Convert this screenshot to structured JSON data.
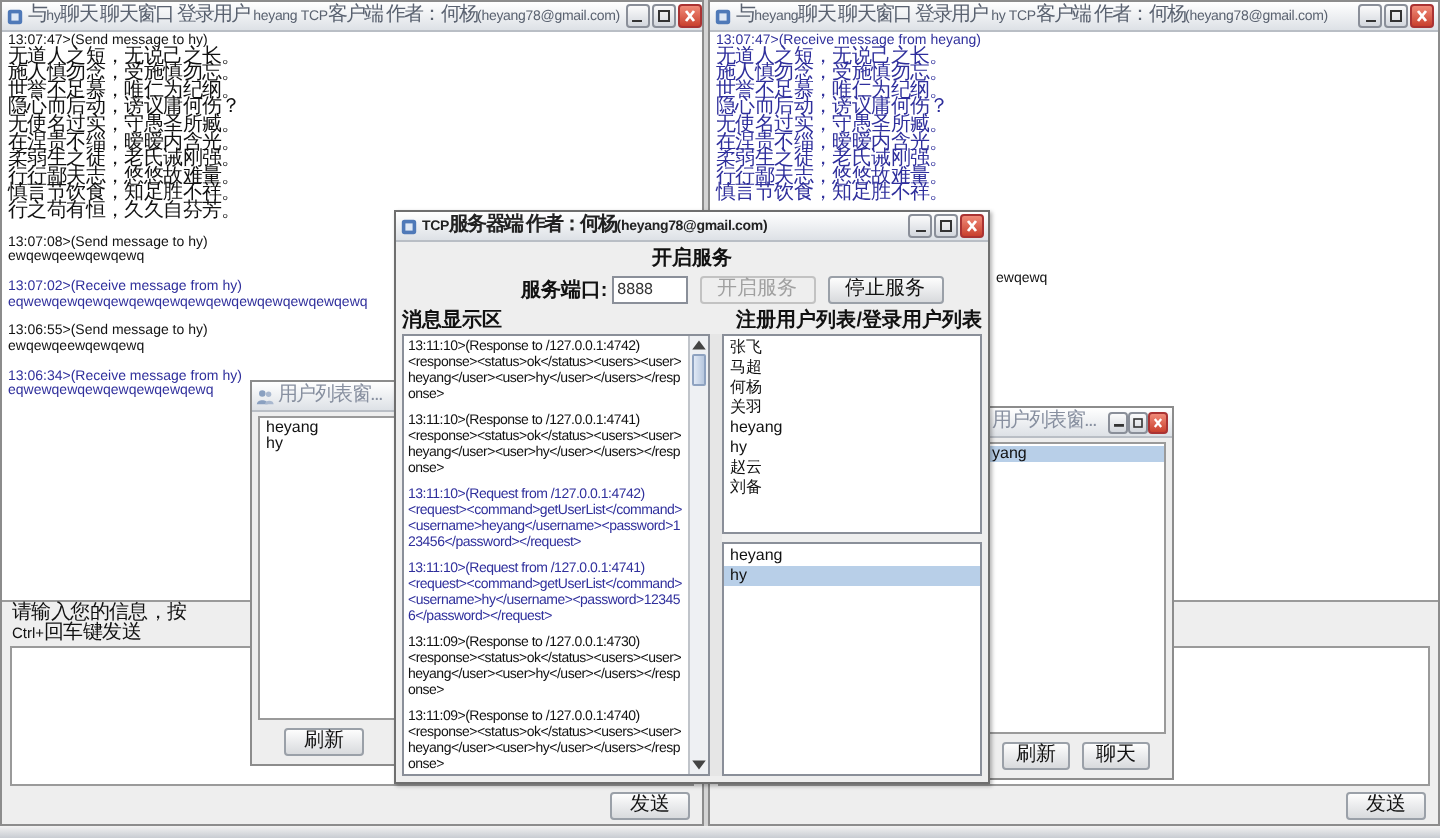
{
  "left_chat": {
    "title": "与hy聊天 聊天窗口 登录用户 heyang TCP客户端 作者：何杨(heyang78@gmail.com)",
    "messages": [
      {
        "kind": "sent",
        "header": "13:07:47>(Send message to hy)",
        "lines": [
          "无道人之短，无说己之长。",
          "施人慎勿念，受施慎勿忘。",
          "世誉不足慕，唯仁为纪纲。",
          "隐心而后动，谤议庸何伤？",
          "无使名过实，守愚圣所臧。",
          "在涅贵不缁，暧暧内含光。",
          "柔弱生之徒，老氏诫刚强。",
          "行行鄙夫志，悠悠故难量。",
          "慎言节饮食，知足胜不祥。",
          "行之苟有恒，久久自芬芳。"
        ]
      },
      {
        "kind": "sent",
        "header": "13:07:08>(Send message to hy)",
        "lines": [
          "ewqewqeewqewqewq"
        ]
      },
      {
        "kind": "received",
        "header": "13:07:02>(Receive message from hy)",
        "lines": [
          "eqwewqewqewqewqewqewqewqewqewqewqewqewqewq"
        ]
      },
      {
        "kind": "sent",
        "header": "13:06:55>(Send message to hy)",
        "lines": [
          "ewqewqeewqewqewq"
        ]
      },
      {
        "kind": "received",
        "header": "13:06:34>(Receive message from hy)",
        "lines": [
          "eqwewqewqewqewqewqewqewq"
        ]
      }
    ],
    "input_label": "请输入您的信息，按Ctrl+回车键发送",
    "send_button": "发送"
  },
  "right_chat": {
    "title": "与heyang聊天 聊天窗口 登录用户 hy TCP客户端 作者：何杨(heyang78@gmail.com)",
    "messages": [
      {
        "kind": "received",
        "header": "13:07:47>(Receive message from heyang)",
        "lines": [
          "无道人之短，无说己之长。",
          "施人慎勿念，受施慎勿忘。",
          "世誉不足慕，唯仁为纪纲。",
          "隐心而后动，谤议庸何伤？",
          "无使名过实，守愚圣所臧。",
          "在涅贵不缁，暧暧内含光。",
          "柔弱生之徒，老氏诫刚强。",
          "行行鄙夫志，悠悠故难量。",
          "慎言节饮食，知足胜不祥。"
        ]
      },
      {
        "kind": "fragment",
        "lines": [
          "ewqewq"
        ]
      }
    ],
    "send_button": "发送"
  },
  "left_user_list": {
    "title": "用户列表窗...",
    "users": [
      {
        "name": "heyang",
        "selected": false
      },
      {
        "name": "hy",
        "selected": false
      }
    ],
    "buttons": [
      "刷新"
    ]
  },
  "right_user_list": {
    "title": "用户列表窗...",
    "users": [
      {
        "name": "yang",
        "selected": true
      }
    ],
    "buttons": [
      "刷新",
      "聊天"
    ]
  },
  "server": {
    "title": "TCP服务器端 作者：何杨(heyang78@gmail.com)",
    "section_title": "开启服务",
    "port_label": "服务端口:",
    "port": "8888",
    "buttons": [
      {
        "label": "开启服务",
        "disabled": true
      },
      {
        "label": "停止服务",
        "disabled": false
      }
    ],
    "log_label": "消息显示区",
    "users_label": "注册用户列表/登录用户列表",
    "log": [
      {
        "kind": "response",
        "header": "13:11:10>(Response to /127.0.0.1:4742)",
        "body": "<response><status>ok</status><users><user>heyang</user><user>hy</user></users></response>"
      },
      {
        "kind": "response",
        "header": "13:11:10>(Response to /127.0.0.1:4741)",
        "body": "<response><status>ok</status><users><user>heyang</user><user>hy</user></users></response>"
      },
      {
        "kind": "request",
        "header": "13:11:10>(Request from /127.0.0.1:4742)",
        "body": "<request><command>getUserList</command><username>heyang</username><password>123456</password></request>"
      },
      {
        "kind": "request",
        "header": "13:11:10>(Request from /127.0.0.1:4741)",
        "body": "<request><command>getUserList</command><username>hy</username><password>123456</password></request>"
      },
      {
        "kind": "response",
        "header": "13:11:09>(Response to /127.0.0.1:4730)",
        "body": "<response><status>ok</status><users><user>heyang</user><user>hy</user></users></response>"
      },
      {
        "kind": "response",
        "header": "13:11:09>(Response to /127.0.0.1:4740)",
        "body": "<response><status>ok</status><users><user>heyang</user><user>hy</user></users></response>"
      }
    ],
    "registered_users": [
      "张飞",
      "马超",
      "何杨",
      "关羽",
      "heyang",
      "hy",
      "赵云",
      "刘备"
    ],
    "online_users": [
      {
        "name": "heyang",
        "selected": false
      },
      {
        "name": "hy",
        "selected": true
      }
    ]
  }
}
